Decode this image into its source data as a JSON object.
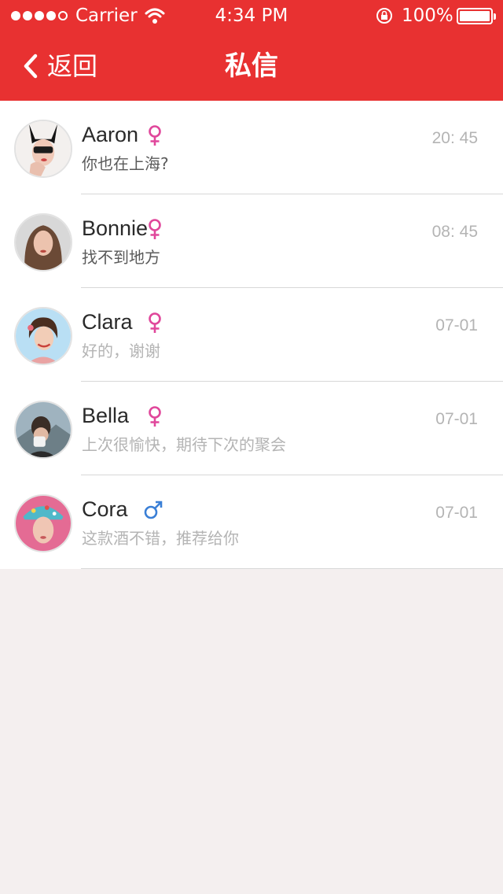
{
  "status_bar": {
    "carrier": "Carrier",
    "time": "4:34 PM",
    "battery": "100%",
    "signal_bars": 4
  },
  "nav": {
    "back_label": "返回",
    "title": "私信"
  },
  "colors": {
    "header": "#e83131",
    "female_icon": "#e0479b",
    "male_icon": "#3a7fd6",
    "background": "#f4efef"
  },
  "conversations": [
    {
      "name": "Aaron",
      "gender": "female-icon",
      "time": "20: 45",
      "preview": "你也在上海?"
    },
    {
      "name": "Bonnie",
      "gender": "female-icon",
      "time": "08: 45",
      "preview": "找不到地方"
    },
    {
      "name": "Clara",
      "gender": "female-icon",
      "time": "07-01",
      "preview": "好的，谢谢"
    },
    {
      "name": "Bella",
      "gender": "female-icon",
      "time": "07-01",
      "preview": "上次很愉快，期待下次的聚会"
    },
    {
      "name": "Cora",
      "gender": "male-icon",
      "time": "07-01",
      "preview": "这款酒不错，推荐给你"
    }
  ]
}
